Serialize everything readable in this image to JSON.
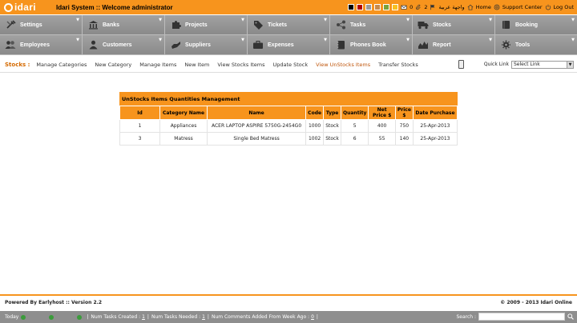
{
  "app": {
    "logo_text": "idari",
    "title": "Idari System :: Welcome administrator"
  },
  "topbar": {
    "colors": [
      "#000000",
      "#b00000",
      "#9a9a9a",
      "#c78a4a",
      "#7aa23a",
      "#f7c020"
    ],
    "messages_count": "0",
    "attachments_count": "2",
    "arabic_label": "واجهة عربية",
    "home_label": "Home",
    "support_label": "Support Center",
    "logout_label": "Log Out"
  },
  "nav": {
    "items": [
      {
        "label": "Settings",
        "icon": "tools-icon"
      },
      {
        "label": "Banks",
        "icon": "bank-icon"
      },
      {
        "label": "Projects",
        "icon": "puzzle-icon"
      },
      {
        "label": "Tickets",
        "icon": "tag-icon"
      },
      {
        "label": "Tasks",
        "icon": "network-icon"
      },
      {
        "label": "Stocks",
        "icon": "truck-icon"
      },
      {
        "label": "Booking",
        "icon": "book-icon"
      },
      {
        "label": "Employees",
        "icon": "people-icon"
      },
      {
        "label": "Customers",
        "icon": "person-icon"
      },
      {
        "label": "Suppliers",
        "icon": "hand-icon"
      },
      {
        "label": "Expenses",
        "icon": "briefcase-icon"
      },
      {
        "label": "Phones Book",
        "icon": "notebook-icon"
      },
      {
        "label": "Report",
        "icon": "chart-icon"
      },
      {
        "label": "Tools",
        "icon": "gear-icon"
      }
    ]
  },
  "subnav": {
    "label": "Stocks :",
    "items": [
      "Manage Categories",
      "New Category",
      "Manage Items",
      "New Item",
      "View Stocks Items",
      "Update Stock",
      "View UnStocks Items",
      "Transfer Stocks"
    ],
    "current": "View UnStocks Items",
    "quick_link_label": "Quick Link",
    "quick_link_value": "Select Link"
  },
  "panel": {
    "title": "UnStocks Items Quantities Management",
    "columns": [
      "Id",
      "Category Name",
      "Name",
      "Code",
      "Type",
      "Quantity",
      "Net Price $",
      "Price $",
      "Date Purchase"
    ],
    "rows": [
      [
        "1",
        "Appliances",
        "ACER LAPTOP ASPIRE 5750G-2454G0",
        "1000",
        "Stock",
        "5",
        "400",
        "750",
        "25-Apr-2013"
      ],
      [
        "3",
        "Matress",
        "Single Bed Matress",
        "1002",
        "Stock",
        "6",
        "55",
        "140",
        "25-Apr-2013"
      ]
    ]
  },
  "footer": {
    "powered": "Powered By Earlyhost :: Version 2.2",
    "copyright": "© 2009 - 2013 Idari Online"
  },
  "statusbar": {
    "today_label": "Today",
    "num_created_label": "Num Tasks Created :",
    "num_created": "1",
    "num_needed_label": "Num Tasks Needed :",
    "num_needed": "1",
    "num_comments_label": "Num Comments Added From Week Ago :",
    "num_comments": "0",
    "search_label": "Search :"
  }
}
